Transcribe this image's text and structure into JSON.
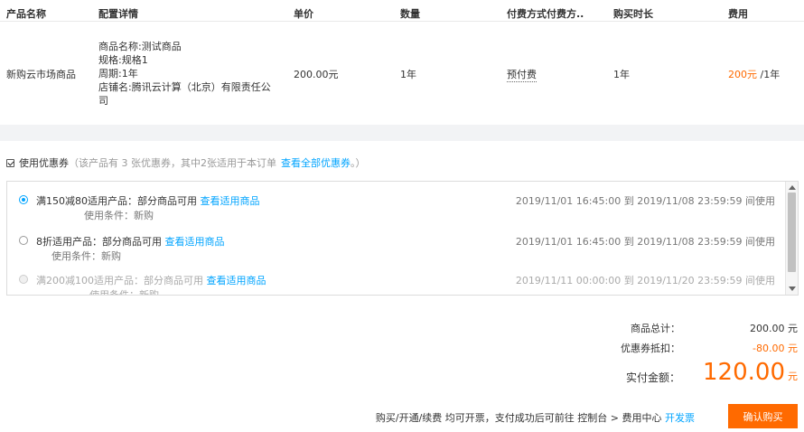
{
  "table": {
    "headers": [
      "产品名称",
      "配置详情",
      "单价",
      "数量",
      "付费方式付费方..",
      "购买时长",
      "费用"
    ],
    "row": {
      "product": "新购云市场商品",
      "details": [
        "商品名称:测试商品",
        "规格:规格1",
        "周期:1年",
        "店铺名:腾讯云计算（北京）有限责任公",
        "司"
      ],
      "unit_price": "200.00元",
      "quantity": "1年",
      "pay_method": "预付费",
      "duration": "1年",
      "fee_amount": "200元",
      "fee_unit": "/1年"
    }
  },
  "coupon": {
    "label": "使用优惠券",
    "info_prefix": "（该产品有 3 张优惠券，其中2张适用于本订单",
    "view_all": "查看全部优惠券",
    "info_suffix": "。）",
    "items": [
      {
        "title": "满150减80适用产品：部分商品可用",
        "link": "查看适用商品",
        "condition": "使用条件：新购",
        "date": "2019/11/01 16:45:00 到 2019/11/08 23:59:59 间使用",
        "state": "selected"
      },
      {
        "title": "8折适用产品：部分商品可用",
        "link": "查看适用商品",
        "condition": "使用条件：新购",
        "date": "2019/11/01 16:45:00 到 2019/11/08 23:59:59 间使用",
        "state": "unselected"
      },
      {
        "title": "满200减100适用产品：部分商品可用",
        "link": "查看适用商品",
        "condition": "使用条件：新购",
        "date": "2019/11/11 00:00:00 到 2019/11/20 23:59:59 间使用",
        "state": "disabled"
      }
    ]
  },
  "summary": {
    "subtotal_label": "商品总计：",
    "subtotal_value": "200.00 元",
    "discount_label": "优惠券抵扣：",
    "discount_value": "-80.00 元",
    "total_label": "实付金额：",
    "total_value": "120.00",
    "total_unit": "元"
  },
  "footer": {
    "note": "购买/开通/续费 均可开票，支付成功后可前往 控制台 > 费用中心",
    "invoice_link": "开发票",
    "confirm_label": "确认购买"
  },
  "colors": {
    "accent": "#ff6a00",
    "link": "#00a4ff"
  }
}
